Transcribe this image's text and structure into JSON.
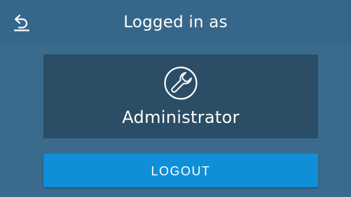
{
  "header": {
    "title": "Logged in as",
    "back_icon": "back-arrow-icon"
  },
  "user": {
    "icon": "wrench-icon",
    "role": "Administrator"
  },
  "actions": {
    "logout_label": "LOGOUT"
  },
  "colors": {
    "header_bg": "#36678a",
    "body_bg": "#3a6a8c",
    "card_bg": "#2b4d65",
    "button_bg": "#0e8fd8",
    "text": "#ffffff"
  }
}
